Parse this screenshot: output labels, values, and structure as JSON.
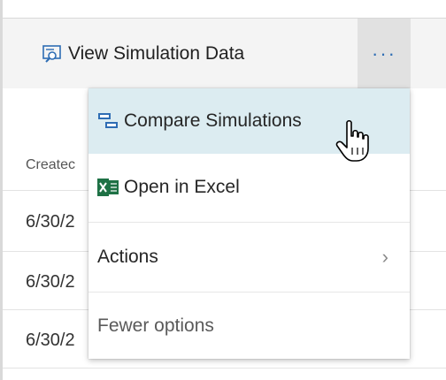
{
  "toolbar": {
    "view_simulation_label": "View Simulation Data",
    "view_simulation_icon": "view-data-icon",
    "more_label": "···",
    "more_icon": "ellipsis-icon"
  },
  "table": {
    "column_header": "Createc",
    "rows": [
      "6/30/2",
      "6/30/2",
      "6/30/2"
    ]
  },
  "menu": {
    "items": [
      {
        "label": "Compare Simulations",
        "icon": "compare-icon"
      },
      {
        "label": "Open in Excel",
        "icon": "excel-icon"
      },
      {
        "label": "Actions",
        "icon": "chevron-right-icon"
      },
      {
        "label": "Fewer options"
      }
    ]
  },
  "colors": {
    "accent": "#2e6db4",
    "hover": "#dcecf1",
    "excel_green": "#1e7145"
  }
}
